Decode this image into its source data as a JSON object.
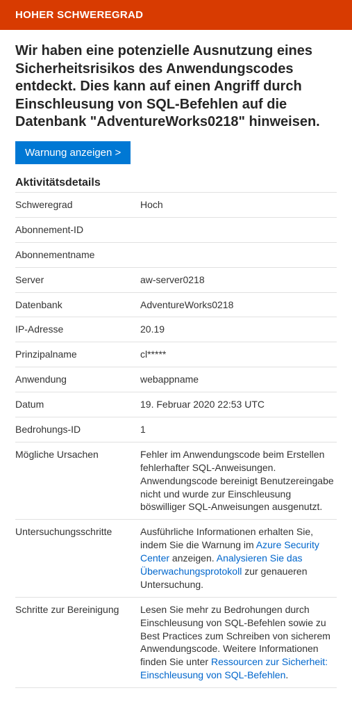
{
  "banner": "HOHER SCHWEREGRAD",
  "title": "Wir haben eine potenzielle Ausnutzung eines Sicherheitsrisikos des Anwendungscodes entdeckt. Dies kann auf einen Angriff durch Einschleusung von SQL-Befehlen auf die Datenbank \"AdventureWorks0218\" hinweisen.",
  "button_label": "Warnung anzeigen >",
  "section_title": "Aktivitätsdetails",
  "rows": {
    "severity": {
      "label": "Schweregrad",
      "value": "Hoch"
    },
    "subscription_id": {
      "label": "Abonnement-ID",
      "value": ""
    },
    "subscription_name": {
      "label": "Abonnementname",
      "value": ""
    },
    "server": {
      "label": "Server",
      "value": "aw-server0218"
    },
    "database": {
      "label": "Datenbank",
      "value": "AdventureWorks0218"
    },
    "ip": {
      "label": "IP-Adresse",
      "value": "20.19"
    },
    "principal": {
      "label": "Prinzipalname",
      "value": "cl*****"
    },
    "application": {
      "label": "Anwendung",
      "value": "webappname"
    },
    "date": {
      "label": "Datum",
      "value": "19. Februar 2020 22:53 UTC"
    },
    "threat_id": {
      "label": "Bedrohungs-ID",
      "value": "1"
    },
    "causes": {
      "label": "Mögliche Ursachen",
      "value": "Fehler im Anwendungscode beim Erstellen fehlerhafter SQL-Anweisungen. Anwendungscode bereinigt Benutzereingabe nicht und wurde zur Einschleusung böswilliger SQL-Anweisungen ausgenutzt."
    },
    "investigate": {
      "label": "Untersuchungsschritte",
      "pre": "Ausführliche Informationen erhalten Sie, indem Sie die Warnung im ",
      "link1": "Azure Security Center",
      "mid": " anzeigen. ",
      "link2": "Analysieren Sie das Überwachungsprotokoll",
      "post": " zur genaueren Untersuchung."
    },
    "remediate": {
      "label": "Schritte zur Bereinigung",
      "pre": "Lesen Sie mehr zu Bedrohungen durch Einschleusung von SQL-Befehlen sowie zu Best Practices zum Schreiben von sicherem Anwendungscode. Weitere Informationen finden Sie unter ",
      "link": "Ressourcen zur Sicherheit: Einschleusung von SQL-Befehlen",
      "post": "."
    }
  }
}
